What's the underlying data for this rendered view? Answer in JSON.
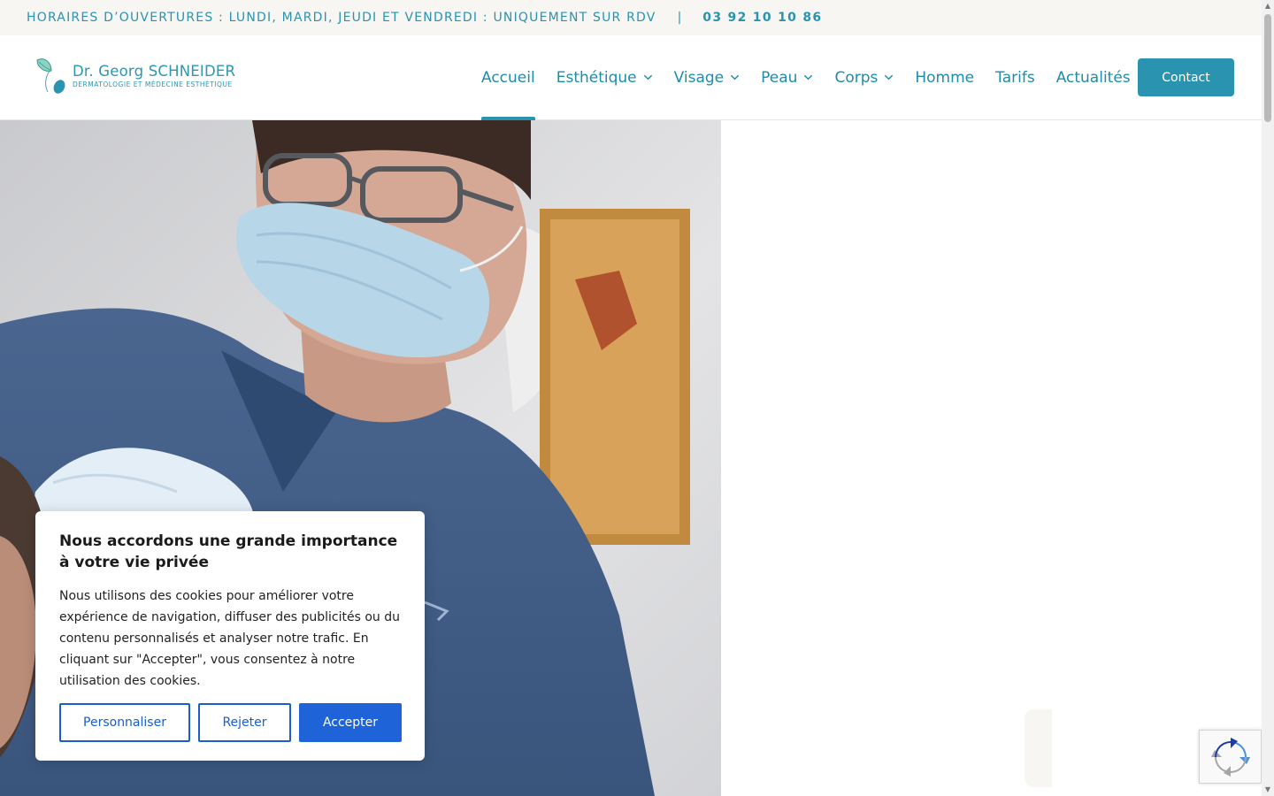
{
  "topbar": {
    "hours": "HORAIRES D’OUVERTURES : LUNDI, MARDI, JEUDI ET VENDREDI : UNIQUEMENT SUR RDV",
    "separator": "|",
    "phone": "03 92 10 10 86"
  },
  "logo": {
    "name": "Dr. Georg SCHNEIDER",
    "subtitle": "DERMATOLOGIE ET MÉDECINE ESTHÉTIQUE"
  },
  "nav": {
    "items": [
      {
        "label": "Accueil",
        "active": true,
        "dropdown": false
      },
      {
        "label": "Esthétique",
        "active": false,
        "dropdown": true
      },
      {
        "label": "Visage",
        "active": false,
        "dropdown": true
      },
      {
        "label": "Peau",
        "active": false,
        "dropdown": true
      },
      {
        "label": "Corps",
        "active": false,
        "dropdown": true
      },
      {
        "label": "Homme",
        "active": false,
        "dropdown": false
      },
      {
        "label": "Tarifs",
        "active": false,
        "dropdown": false
      },
      {
        "label": "Actualités",
        "active": false,
        "dropdown": false
      }
    ],
    "contact_label": "Contact"
  },
  "cookie": {
    "title": "Nous accordons une grande importance à votre vie privée",
    "body": "Nous utilisons des cookies pour améliorer votre expérience de navigation, diffuser des publicités ou du contenu personnalisés et analyser notre trafic. En cliquant sur \"Accepter\", vous consentez à notre utilisation des cookies.",
    "customize_label": "Personnaliser",
    "reject_label": "Rejeter",
    "accept_label": "Accepter"
  },
  "colors": {
    "brand": "#2a93b0",
    "topbar_bg": "#f8f6f2",
    "cookie_accent": "#1f63d8"
  },
  "icons": {
    "nav_dropdown": "chevron-down-icon",
    "logo": "leaf-drop-logo-icon",
    "recaptcha": "recaptcha-icon"
  }
}
